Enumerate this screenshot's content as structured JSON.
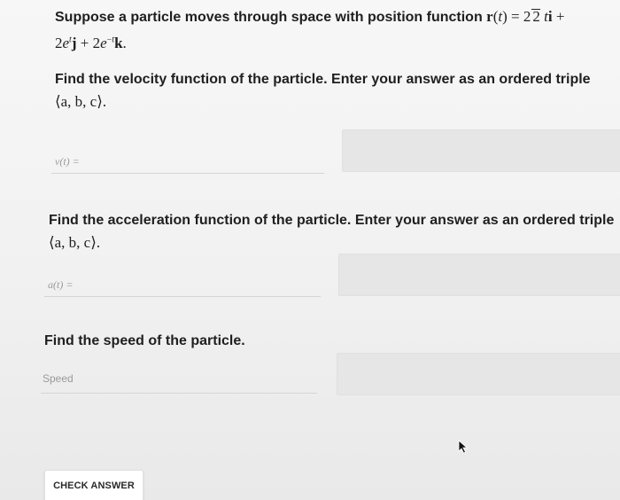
{
  "problem": {
    "intro": "Suppose a particle moves through space with position function",
    "position_function": {
      "lhs": "r(t) = 2√2 ti + 2eᵗj + 2e⁻ᵗk."
    }
  },
  "questions": {
    "velocity": {
      "prompt": "Find the velocity function of the particle. Enter your answer as an ordered triple",
      "format": "⟨a, b, c⟩.",
      "field_label": "v(t) =",
      "value": ""
    },
    "acceleration": {
      "prompt": "Find the acceleration function of the particle. Enter your answer as an ordered triple",
      "format": "⟨a, b, c⟩.",
      "field_label": "a(t) =",
      "value": ""
    },
    "speed": {
      "prompt": "Find the speed of the particle.",
      "placeholder": "Speed",
      "value": ""
    }
  },
  "actions": {
    "check_answer_label": "CHECK ANSWER"
  }
}
